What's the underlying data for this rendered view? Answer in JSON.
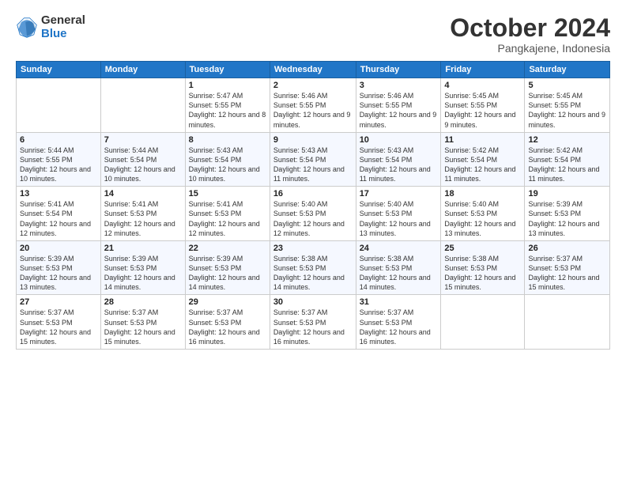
{
  "logo": {
    "general": "General",
    "blue": "Blue"
  },
  "title": {
    "month": "October 2024",
    "location": "Pangkajene, Indonesia"
  },
  "weekdays": [
    "Sunday",
    "Monday",
    "Tuesday",
    "Wednesday",
    "Thursday",
    "Friday",
    "Saturday"
  ],
  "weeks": [
    [
      {
        "day": "",
        "info": ""
      },
      {
        "day": "",
        "info": ""
      },
      {
        "day": "1",
        "info": "Sunrise: 5:47 AM\nSunset: 5:55 PM\nDaylight: 12 hours and 8 minutes."
      },
      {
        "day": "2",
        "info": "Sunrise: 5:46 AM\nSunset: 5:55 PM\nDaylight: 12 hours and 9 minutes."
      },
      {
        "day": "3",
        "info": "Sunrise: 5:46 AM\nSunset: 5:55 PM\nDaylight: 12 hours and 9 minutes."
      },
      {
        "day": "4",
        "info": "Sunrise: 5:45 AM\nSunset: 5:55 PM\nDaylight: 12 hours and 9 minutes."
      },
      {
        "day": "5",
        "info": "Sunrise: 5:45 AM\nSunset: 5:55 PM\nDaylight: 12 hours and 9 minutes."
      }
    ],
    [
      {
        "day": "6",
        "info": "Sunrise: 5:44 AM\nSunset: 5:55 PM\nDaylight: 12 hours and 10 minutes."
      },
      {
        "day": "7",
        "info": "Sunrise: 5:44 AM\nSunset: 5:54 PM\nDaylight: 12 hours and 10 minutes."
      },
      {
        "day": "8",
        "info": "Sunrise: 5:43 AM\nSunset: 5:54 PM\nDaylight: 12 hours and 10 minutes."
      },
      {
        "day": "9",
        "info": "Sunrise: 5:43 AM\nSunset: 5:54 PM\nDaylight: 12 hours and 11 minutes."
      },
      {
        "day": "10",
        "info": "Sunrise: 5:43 AM\nSunset: 5:54 PM\nDaylight: 12 hours and 11 minutes."
      },
      {
        "day": "11",
        "info": "Sunrise: 5:42 AM\nSunset: 5:54 PM\nDaylight: 12 hours and 11 minutes."
      },
      {
        "day": "12",
        "info": "Sunrise: 5:42 AM\nSunset: 5:54 PM\nDaylight: 12 hours and 11 minutes."
      }
    ],
    [
      {
        "day": "13",
        "info": "Sunrise: 5:41 AM\nSunset: 5:54 PM\nDaylight: 12 hours and 12 minutes."
      },
      {
        "day": "14",
        "info": "Sunrise: 5:41 AM\nSunset: 5:53 PM\nDaylight: 12 hours and 12 minutes."
      },
      {
        "day": "15",
        "info": "Sunrise: 5:41 AM\nSunset: 5:53 PM\nDaylight: 12 hours and 12 minutes."
      },
      {
        "day": "16",
        "info": "Sunrise: 5:40 AM\nSunset: 5:53 PM\nDaylight: 12 hours and 12 minutes."
      },
      {
        "day": "17",
        "info": "Sunrise: 5:40 AM\nSunset: 5:53 PM\nDaylight: 12 hours and 13 minutes."
      },
      {
        "day": "18",
        "info": "Sunrise: 5:40 AM\nSunset: 5:53 PM\nDaylight: 12 hours and 13 minutes."
      },
      {
        "day": "19",
        "info": "Sunrise: 5:39 AM\nSunset: 5:53 PM\nDaylight: 12 hours and 13 minutes."
      }
    ],
    [
      {
        "day": "20",
        "info": "Sunrise: 5:39 AM\nSunset: 5:53 PM\nDaylight: 12 hours and 13 minutes."
      },
      {
        "day": "21",
        "info": "Sunrise: 5:39 AM\nSunset: 5:53 PM\nDaylight: 12 hours and 14 minutes."
      },
      {
        "day": "22",
        "info": "Sunrise: 5:39 AM\nSunset: 5:53 PM\nDaylight: 12 hours and 14 minutes."
      },
      {
        "day": "23",
        "info": "Sunrise: 5:38 AM\nSunset: 5:53 PM\nDaylight: 12 hours and 14 minutes."
      },
      {
        "day": "24",
        "info": "Sunrise: 5:38 AM\nSunset: 5:53 PM\nDaylight: 12 hours and 14 minutes."
      },
      {
        "day": "25",
        "info": "Sunrise: 5:38 AM\nSunset: 5:53 PM\nDaylight: 12 hours and 15 minutes."
      },
      {
        "day": "26",
        "info": "Sunrise: 5:37 AM\nSunset: 5:53 PM\nDaylight: 12 hours and 15 minutes."
      }
    ],
    [
      {
        "day": "27",
        "info": "Sunrise: 5:37 AM\nSunset: 5:53 PM\nDaylight: 12 hours and 15 minutes."
      },
      {
        "day": "28",
        "info": "Sunrise: 5:37 AM\nSunset: 5:53 PM\nDaylight: 12 hours and 15 minutes."
      },
      {
        "day": "29",
        "info": "Sunrise: 5:37 AM\nSunset: 5:53 PM\nDaylight: 12 hours and 16 minutes."
      },
      {
        "day": "30",
        "info": "Sunrise: 5:37 AM\nSunset: 5:53 PM\nDaylight: 12 hours and 16 minutes."
      },
      {
        "day": "31",
        "info": "Sunrise: 5:37 AM\nSunset: 5:53 PM\nDaylight: 12 hours and 16 minutes."
      },
      {
        "day": "",
        "info": ""
      },
      {
        "day": "",
        "info": ""
      }
    ]
  ]
}
